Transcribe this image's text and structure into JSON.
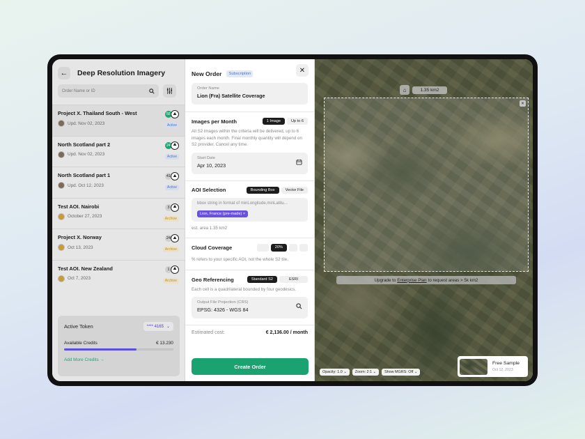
{
  "left_panel": {
    "title": "Deep Resolution Imagery",
    "search_placeholder": "Order Name or ID",
    "projects": [
      {
        "name": "Project X. Thailand South - West",
        "date": "Upd. Nov 02, 2023",
        "count": "55",
        "status": "Active"
      },
      {
        "name": "North Scotland part 2",
        "date": "Upd. Nov 02, 2023",
        "count": "24",
        "status": "Active"
      },
      {
        "name": "North Scotland part 1",
        "date": "Upd. Oct 12, 2023",
        "count": "41",
        "status": "Active"
      },
      {
        "name": "Test AOI. Nairobi",
        "date": "October 27, 2023",
        "count": "3",
        "status": "Archive"
      },
      {
        "name": "Project X. Norway",
        "date": "Oct 13, 2023",
        "count": "24",
        "status": "Archive"
      },
      {
        "name": "Test AOI. New Zealand",
        "date": "Oct 7, 2023",
        "count": "1",
        "status": "Archive"
      }
    ],
    "token": {
      "title": "Active Token",
      "selected": "**** 4165",
      "credits_label": "Available Credits",
      "credits_value": "€ 13.230",
      "credits_fraction": 0.66,
      "add_link": "Add More Credits →"
    }
  },
  "order": {
    "title": "New Order",
    "badge": "Subscription",
    "order_name_label": "Order Name",
    "order_name_value": "Lion (Fra) Satellite Coverage",
    "images": {
      "title": "Images per Month",
      "options": [
        "1 Image",
        "Up to 6"
      ],
      "selected": "1 Image",
      "desc": "All S2 images within the criteria will be delivered, up to 6 images each month. Final monthly quantity will depend on S2 provider. Cancel any time.",
      "start_label": "Start Date",
      "start_value": "Apr 10, 2023"
    },
    "aoi": {
      "title": "AOI Selection",
      "options": [
        "Bounding Box",
        "Vector File"
      ],
      "selected": "Bounding Box",
      "placeholder": "bbox string in format of minLongitude,minLatitu...",
      "chip": "Lion, France (pre-made)",
      "est_area": "est. area 1.35 km2"
    },
    "cloud": {
      "title": "Cloud Coverage",
      "options": [
        "",
        "20%",
        "",
        ""
      ],
      "selected": "20%",
      "desc": "% refers to your specific AOI, not the whole S2 tile."
    },
    "geo": {
      "title": "Geo Referencing",
      "options": [
        "Standard S2",
        "ESRI"
      ],
      "selected": "Standard S2",
      "desc": "Each cell is a quadrilateral bounded by four geodesics.",
      "proj_label": "Output File Projection (CRS)",
      "proj_value": "EPSG: 4326 - WGS 84"
    },
    "est_cost_label": "Estimated cost:",
    "est_cost_value": "€ 2,136.00 / month",
    "create_button": "Create Order"
  },
  "map": {
    "area": "1.35 km2",
    "upgrade_pre": "Upgrade to",
    "upgrade_link": "Enterprise Plan",
    "upgrade_post": "to request areas > 5k km2",
    "controls": [
      "Opacity: 1.0",
      "Zoom: 2:1",
      "Show MGRS: Off"
    ],
    "free_sample_title": "Free Sample",
    "free_sample_date": "Oct 12, 2023"
  }
}
